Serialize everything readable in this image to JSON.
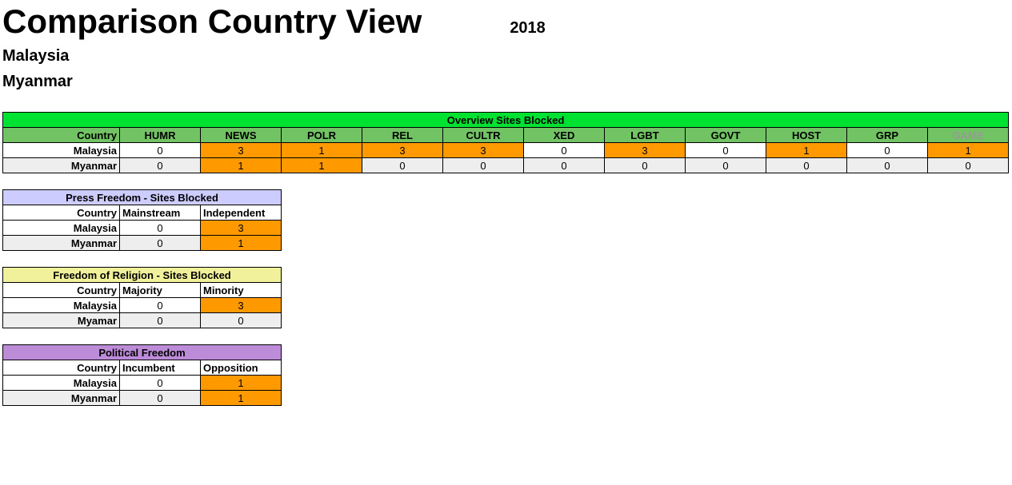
{
  "title": "Comparison Country View",
  "year": "2018",
  "countries": [
    "Malaysia",
    "Myanmar"
  ],
  "overview": {
    "banner": "Overview Sites Blocked",
    "country_header": "Country",
    "categories": [
      "HUMR",
      "NEWS",
      "POLR",
      "REL",
      "CULTR",
      "XED",
      "LGBT",
      "GOVT",
      "HOST",
      "GRP",
      "GAME"
    ],
    "rows": [
      {
        "country": "Malaysia",
        "values": [
          0,
          3,
          1,
          3,
          3,
          0,
          3,
          0,
          1,
          0,
          1
        ]
      },
      {
        "country": "Myanmar",
        "values": [
          0,
          1,
          1,
          0,
          0,
          0,
          0,
          0,
          0,
          0,
          0
        ]
      }
    ]
  },
  "press": {
    "banner": "Press Freedom - Sites Blocked",
    "country_header": "Country",
    "cols": [
      "Mainstream",
      "Independent"
    ],
    "rows": [
      {
        "country": "Malaysia",
        "values": [
          0,
          3
        ]
      },
      {
        "country": "Myanmar",
        "values": [
          0,
          1
        ]
      }
    ]
  },
  "religion": {
    "banner": "Freedom of Religion - Sites Blocked",
    "country_header": "Country",
    "cols": [
      "Majority",
      "Minority"
    ],
    "rows": [
      {
        "country": "Malaysia",
        "values": [
          0,
          3
        ]
      },
      {
        "country": "Myamar",
        "values": [
          0,
          0
        ]
      }
    ]
  },
  "political": {
    "banner": "Political Freedom",
    "country_header": "Country",
    "cols": [
      "Incumbent",
      "Opposition"
    ],
    "rows": [
      {
        "country": "Malaysia",
        "values": [
          0,
          1
        ]
      },
      {
        "country": "Myanmar",
        "values": [
          0,
          1
        ]
      }
    ]
  }
}
